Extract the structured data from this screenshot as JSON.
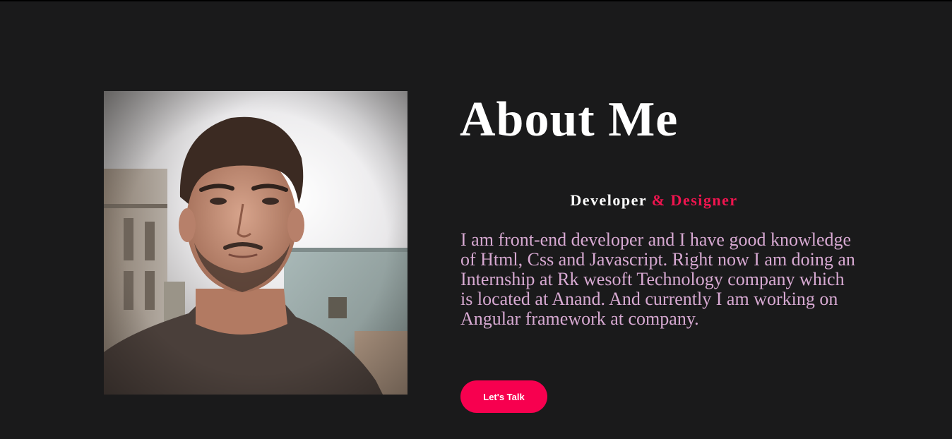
{
  "about": {
    "title": "About Me",
    "role_primary": "Developer",
    "role_accent": "& Designer",
    "bio": "I am front-end developer and I have good knowledge of Html, Css and Javascript. Right now I am doing an Internship at Rk wesoft Technology company which is located at Anand. And currently I am working on Angular framework at company.",
    "cta_label": "Let's Talk"
  },
  "colors": {
    "background": "#1a1a1b",
    "accent": "#f0144f",
    "button": "#f7004f",
    "bio_text": "#d7a9d2",
    "heading_text": "#ffffff"
  }
}
